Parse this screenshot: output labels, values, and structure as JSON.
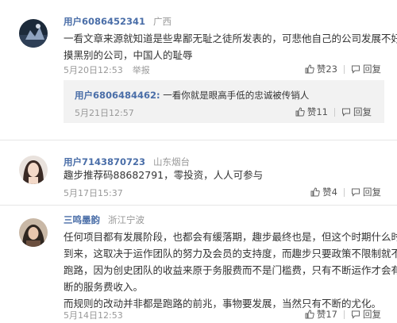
{
  "comments": [
    {
      "user": "用户6086452341",
      "location": "广西",
      "lines": [
        "一看文章来源就知道是些卑鄙无耻之徒所发表的，可悲他自己的公司发展不好去",
        "摸黑别的公司，中国人的耻辱"
      ],
      "time": "5月20日12:53",
      "report": "举报",
      "likes": "赞23",
      "reply_label": "回复",
      "reply": {
        "user": "用户6806484462:",
        "text": " 一看你就是眼高手低的忠诚被传销人",
        "time": "5月21日12:57",
        "likes": "赞11",
        "reply_label": "回复"
      }
    },
    {
      "user": "用户7143870723",
      "location": "山东烟台",
      "lines": [
        "趣步推荐码88682791，零投资，人人可参与"
      ],
      "time": "5月17日15:37",
      "likes": "赞4",
      "reply_label": "回复"
    },
    {
      "user": "三鸣墨韵",
      "location": "浙江宁波",
      "lines": [
        "任何项目都有发展阶段，也都会有缓落期，趣步最终也是，但这个时期什么时候",
        "到来，这取决于运作团队的努力及会员的支持度，而趣步只要政策不限制就不会",
        "跑路，因为创史团队的收益来原于务服费而不是门槛费，只有不断运作才会有不",
        "断的服务费收入。",
        "而规则的改动并非都是跑路的前兆，事物要发展，当然只有不断的尤化。"
      ],
      "time": "5月14日12:53",
      "likes": "赞17",
      "reply_label": "回复"
    }
  ],
  "colors": {
    "username": "#4a6ea8",
    "meta": "#999999",
    "reply_bg": "#f2f2f2"
  },
  "icons": [
    "thumbs-up-icon",
    "comment-bubble-icon"
  ]
}
